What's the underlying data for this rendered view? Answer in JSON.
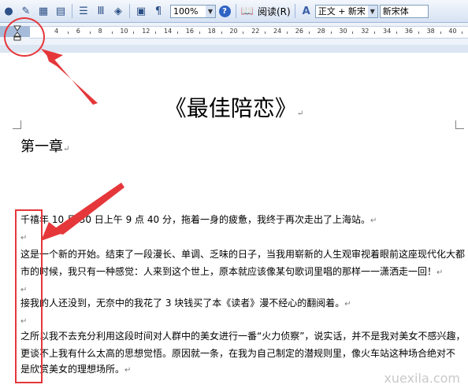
{
  "toolbar": {
    "zoom_value": "100%",
    "read_label": "阅读(R)",
    "style_value": "正文 + 新宋",
    "font_value": "新宋体"
  },
  "ruler": {
    "numbers": [
      "4",
      "6",
      "8",
      "10",
      "12",
      "14",
      "16",
      "18",
      "20",
      "22",
      "24",
      "26",
      "28",
      "30",
      "32",
      "34",
      "36",
      "38",
      "40"
    ]
  },
  "document": {
    "title": "《最佳陪恋》",
    "chapter": "第一章",
    "paragraphs": [
      "千禧年 10 月 30 日上午 9 点 40 分，拖着一身的疲惫，我终于再次走出了上海站。",
      "",
      "这是一个新的开始。结束了一段漫长、单调、乏味的日子，当我用崭新的人生观审视着眼前这座现代化大都",
      "市的时候，我只有一种感觉：人来到这个世上，原本就应该像某句歌词里唱的那样一一潇洒走一回！",
      "接我的人还没到，无奈中的我花了 3 块钱买了本《读者》漫不经心的翻阅着。",
      "之所以我不去充分利用这段时间对人群中的美女进行一番“火力侦察”，说实话，并不是我对美女不感兴趣，",
      "更谈不上我有什么太高的思想觉悟。原因就一条，在我为自己制定的潜规则里，像火车站这种场合绝对不",
      "是欣赏美女的理想场所。"
    ]
  },
  "watermark": "xuexila.com",
  "colors": {
    "annotation": "#e5373a",
    "toolbar_bg": "#d6e2f3"
  }
}
